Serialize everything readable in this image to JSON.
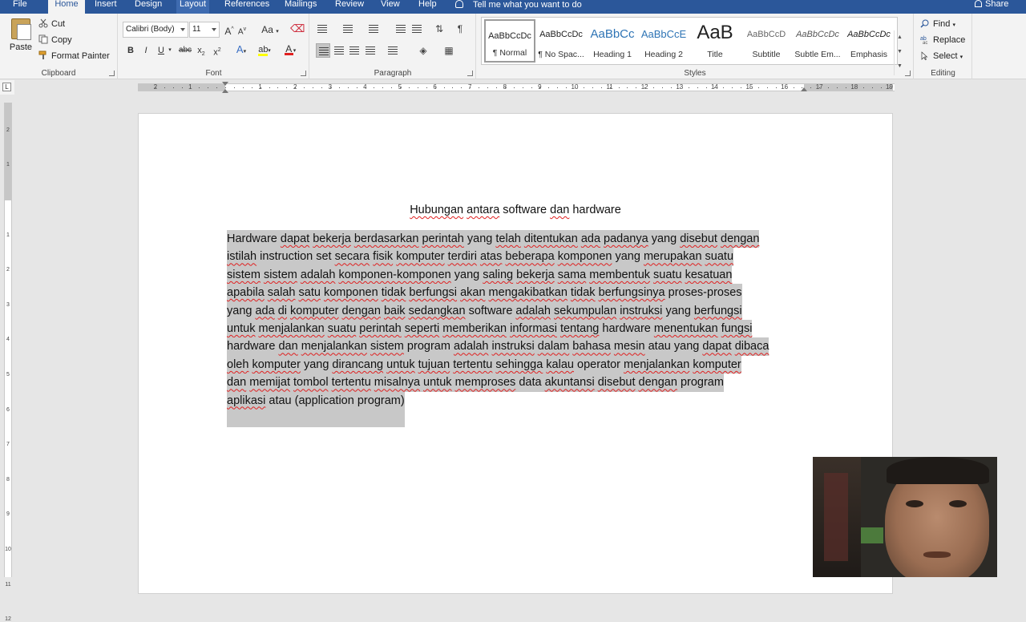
{
  "tabs": [
    {
      "label": "File",
      "state": "normal"
    },
    {
      "label": "Home",
      "state": "active"
    },
    {
      "label": "Insert",
      "state": "normal"
    },
    {
      "label": "Design",
      "state": "normal"
    },
    {
      "label": "Layout",
      "state": "hover"
    },
    {
      "label": "References",
      "state": "normal"
    },
    {
      "label": "Mailings",
      "state": "normal"
    },
    {
      "label": "Review",
      "state": "normal"
    },
    {
      "label": "View",
      "state": "normal"
    },
    {
      "label": "Help",
      "state": "normal"
    }
  ],
  "tell_me": "Tell me what you want to do",
  "share": "Share",
  "clipboard": {
    "paste": "Paste",
    "cut": "Cut",
    "copy": "Copy",
    "format_painter": "Format Painter",
    "label": "Clipboard"
  },
  "font": {
    "name": "Calibri (Body)",
    "size": "11",
    "grow": "A",
    "shrink": "A",
    "case": "Aa",
    "bold": "B",
    "italic": "I",
    "underline": "U",
    "strike": "abc",
    "subscript": "x",
    "superscript": "x",
    "label": "Font"
  },
  "paragraph": {
    "pilcrow": "¶",
    "label": "Paragraph"
  },
  "styles": {
    "items": [
      {
        "preview": "AaBbCcDc",
        "name": "¶ Normal",
        "selected": true
      },
      {
        "preview": "AaBbCcDc",
        "name": "¶ No Spac..."
      },
      {
        "preview": "AaBbCc",
        "name": "Heading 1"
      },
      {
        "preview": "AaBbCcE",
        "name": "Heading 2"
      },
      {
        "preview": "AaB",
        "name": "Title"
      },
      {
        "preview": "AaBbCcD",
        "name": "Subtitle"
      },
      {
        "preview": "AaBbCcDc",
        "name": "Subtle Em..."
      },
      {
        "preview": "AaBbCcDc",
        "name": "Emphasis"
      }
    ],
    "label": "Styles"
  },
  "editing": {
    "find": "Find",
    "replace": "Replace",
    "select": "Select",
    "label": "Editing"
  },
  "ruler": {
    "corner": "L",
    "h_ticks": [
      "2",
      "1",
      "1",
      "2",
      "3",
      "4",
      "5",
      "6",
      "7",
      "8",
      "9",
      "10",
      "11",
      "12",
      "13",
      "14",
      "15",
      "16",
      "17",
      "18",
      "19"
    ],
    "v_ticks": [
      "2",
      "1",
      "1",
      "2",
      "3",
      "4",
      "5",
      "6",
      "7",
      "8",
      "9",
      "10",
      "11",
      "12"
    ]
  },
  "document": {
    "title_parts": [
      {
        "text": "Hubungan",
        "spell": true
      },
      {
        "text": " ",
        "spell": false
      },
      {
        "text": "antara",
        "spell": true
      },
      {
        "text": " software ",
        "spell": false
      },
      {
        "text": "dan",
        "spell": true
      },
      {
        "text": " hardware",
        "spell": false
      }
    ],
    "lines": [
      "Hardware dapat bekerja berdasarkan perintah yang telah ditentukan ada padanya yang disebut dengan",
      "istilah instruction set secara fisik komputer terdiri atas beberapa komponen yang merupakan suatu",
      "sistem sistem adalah komponen-komponen yang saling bekerja sama membentuk suatu kesatuan",
      "apabila salah satu komponen tidak berfungsi akan mengakibatkan tidak berfungsinya proses-proses",
      "yang ada di komputer dengan baik sedangkan software adalah sekumpulan instruksi yang berfungsi",
      "untuk menjalankan suatu perintah seperti memberikan informasi tentang hardware menentukan fungsi",
      "hardware dan menjalankan sistem program adalah instruksi dalam bahasa mesin atau yang dapat dibaca",
      "oleh komputer yang dirancang untuk tujuan tertentu sehingga kalau operator menjalankan komputer",
      "dan memijat tombol tertentu misalnya untuk memproses data akuntansi disebut dengan program",
      "aplikasi atau (application program)"
    ],
    "no_spell": [
      "Hardware",
      "hardware",
      "software",
      "instruction",
      "set",
      "yang",
      "data",
      "operator",
      "program",
      "program)",
      "(application",
      "proses-proses",
      "atau"
    ]
  },
  "colors": {
    "ribbon_tab_bar": "#2b579a",
    "ribbon": "#f3f3f3",
    "selection": "#c8c8c8",
    "spell_underline": "#e02020"
  }
}
